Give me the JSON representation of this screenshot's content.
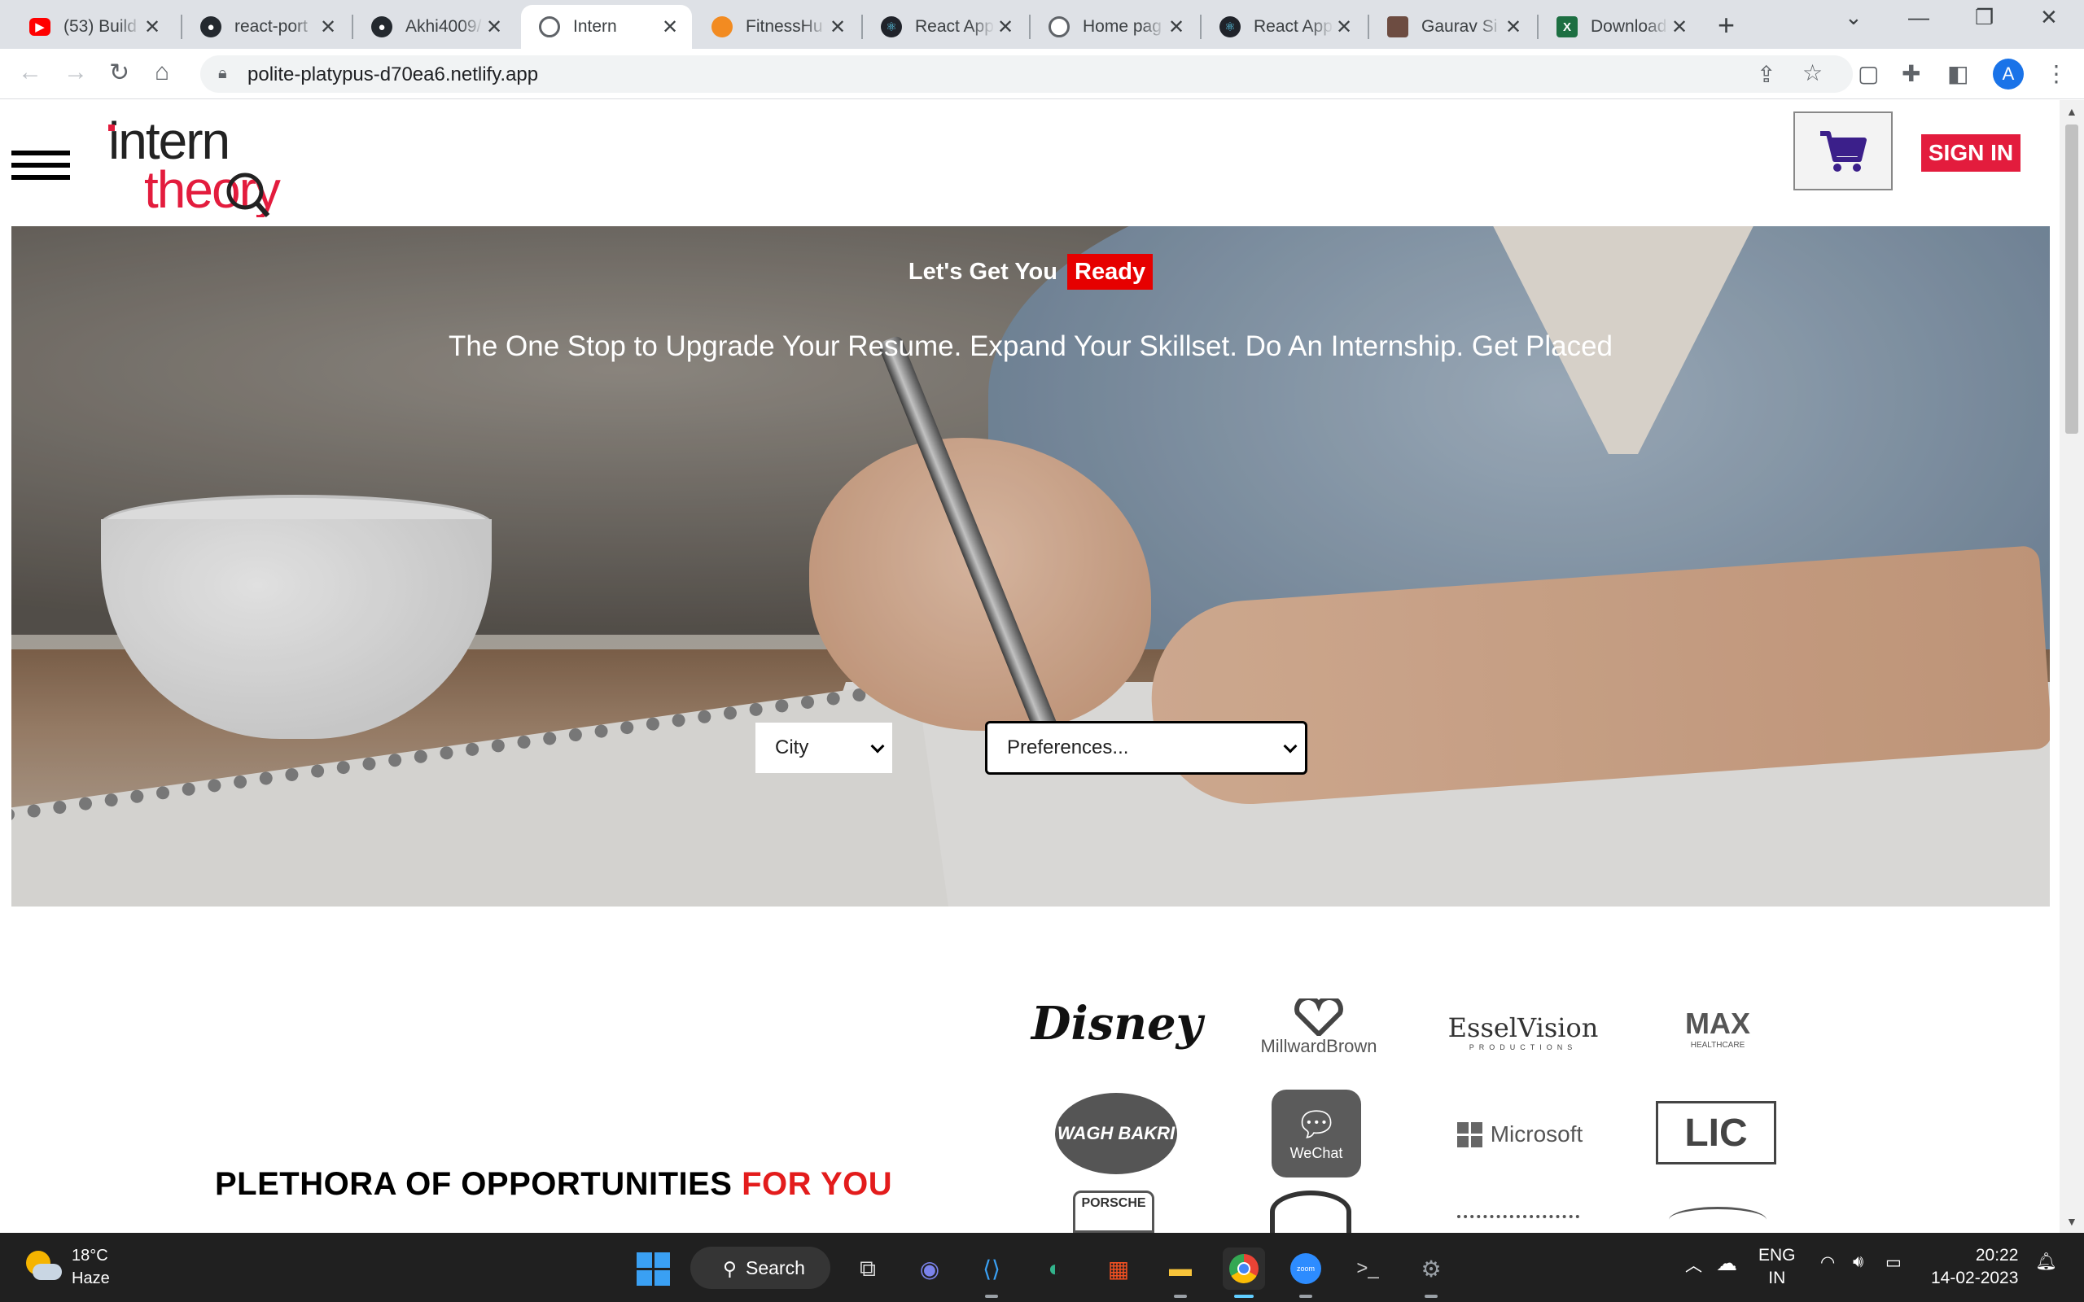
{
  "browser": {
    "tabs": [
      {
        "title": "(53) Build",
        "icon": "youtube-icon",
        "color": "#ff0000",
        "active": false
      },
      {
        "title": "react-port",
        "icon": "github-icon",
        "color": "#24292f",
        "active": false
      },
      {
        "title": "Akhi4009/",
        "icon": "github-icon",
        "color": "#24292f",
        "active": false
      },
      {
        "title": "Intern",
        "icon": "globe-icon",
        "color": "#5f6368",
        "active": true
      },
      {
        "title": "FitnessHu",
        "icon": "fitness-icon",
        "color": "#f28b21",
        "active": false
      },
      {
        "title": "React App",
        "icon": "react-icon",
        "color": "#20232a",
        "active": false
      },
      {
        "title": "Home pag",
        "icon": "globe-icon",
        "color": "#5f6368",
        "active": false
      },
      {
        "title": "React App",
        "icon": "react-icon",
        "color": "#20232a",
        "active": false
      },
      {
        "title": "Gaurav Si",
        "icon": "avatar-icon",
        "color": "#6d4c41",
        "active": false
      },
      {
        "title": "Download",
        "icon": "excel-icon",
        "color": "#1d6f42",
        "active": false
      }
    ],
    "url": "polite-platypus-d70ea6.netlify.app",
    "profile_initial": "A"
  },
  "page": {
    "logo_text_1": "intern",
    "logo_text_2": "theory",
    "signin_label": "SIGN IN",
    "hero": {
      "headline": "Let's Get You",
      "headline_highlight": "Ready",
      "subheadline": "The One Stop to Upgrade Your Resume. Expand Your Skillset. Do An Internship. Get Placed",
      "city_select": "City",
      "preferences_select": "Preferences..."
    },
    "opportunities_title": "PLETHORA OF OPPORTUNITIES",
    "opportunities_highlight": "FOR YOU",
    "brands": [
      "Disney",
      "MillwardBrown",
      "EsselVision",
      "MAX",
      "WAGH BAKRI",
      "WeChat",
      "Microsoft",
      "LIC",
      "PORSCHE"
    ],
    "brand_sublabels": {
      "esselvision": "PRODUCTIONS",
      "max": "HEALTHCARE"
    }
  },
  "taskbar": {
    "weather_temp": "18°C",
    "weather_desc": "Haze",
    "search_label": "Search",
    "lang_1": "ENG",
    "lang_2": "IN",
    "time": "20:22",
    "date": "14-02-2023"
  },
  "colors": {
    "brand_red": "#e31c3d",
    "accent_red": "#e60000",
    "taskbar": "#202020"
  }
}
